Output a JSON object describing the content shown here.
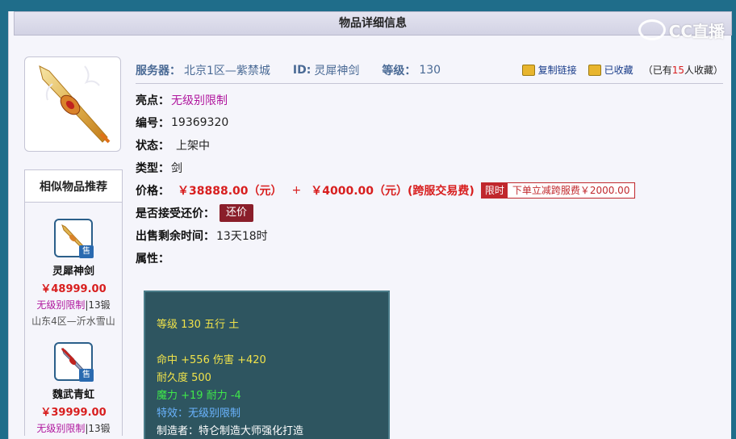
{
  "header": {
    "title": "物品详细信息"
  },
  "watermark": {
    "text": "CC直播"
  },
  "item": {
    "image_icon": "sword-icon",
    "server_label": "服务器：",
    "server_value": "北京1区—紫禁城",
    "id_label": "ID:",
    "id_value": "灵犀神剑",
    "level_label": "等级：",
    "level_value": "130",
    "copy_link_label": "复制链接",
    "favorited_label": "已收藏",
    "fav_count_prefix": "（已有",
    "fav_count_num": "15",
    "fav_count_suffix": "人收藏）",
    "highlight_label": "亮点：",
    "highlight_value": "无级别限制",
    "serial_label": "编号：",
    "serial_value": "19369320",
    "status_label": "状态：",
    "status_value": "上架中",
    "type_label": "类型：",
    "type_value": "剑",
    "price_label": "价格：",
    "price_main": "￥38888.00（元）",
    "price_plus": "+",
    "price_extra": "￥4000.00（元）(跨服交易费)",
    "limit_tag": "限时",
    "limit_text": "下单立减跨服费￥2000.00",
    "counter_label": "是否接受还价：",
    "counter_button": "还价",
    "time_label": "出售剩余时间：",
    "time_value": "13天18时",
    "attr_label": "属性："
  },
  "attributes": {
    "line1": "等级 130 五行 土",
    "line2": "命中 +556 伤害 +420",
    "line3": "耐久度 500",
    "line4": "魔力 +19 耐力 -4",
    "line5": "特效：无级别限制",
    "line6": "制造者：特仑制造大师强化打造"
  },
  "colors": {
    "accent": "#1f6d8a",
    "price_red": "#d81e1e",
    "magenta": "#b0179e",
    "attr_bg": "#2e5560"
  },
  "recommend": {
    "title": "相似物品推荐",
    "items": [
      {
        "name": "灵犀神剑",
        "price": "￥48999.00",
        "tag": "无级别限制",
        "sep": "|",
        "forge": "13锻",
        "server": "山东4区—沂水雪山",
        "sell_tag": "售"
      },
      {
        "name": "魏武青虹",
        "price": "￥39999.00",
        "tag": "无级别限制",
        "sep": "|",
        "forge": "13锻",
        "sell_tag": "售"
      }
    ]
  }
}
